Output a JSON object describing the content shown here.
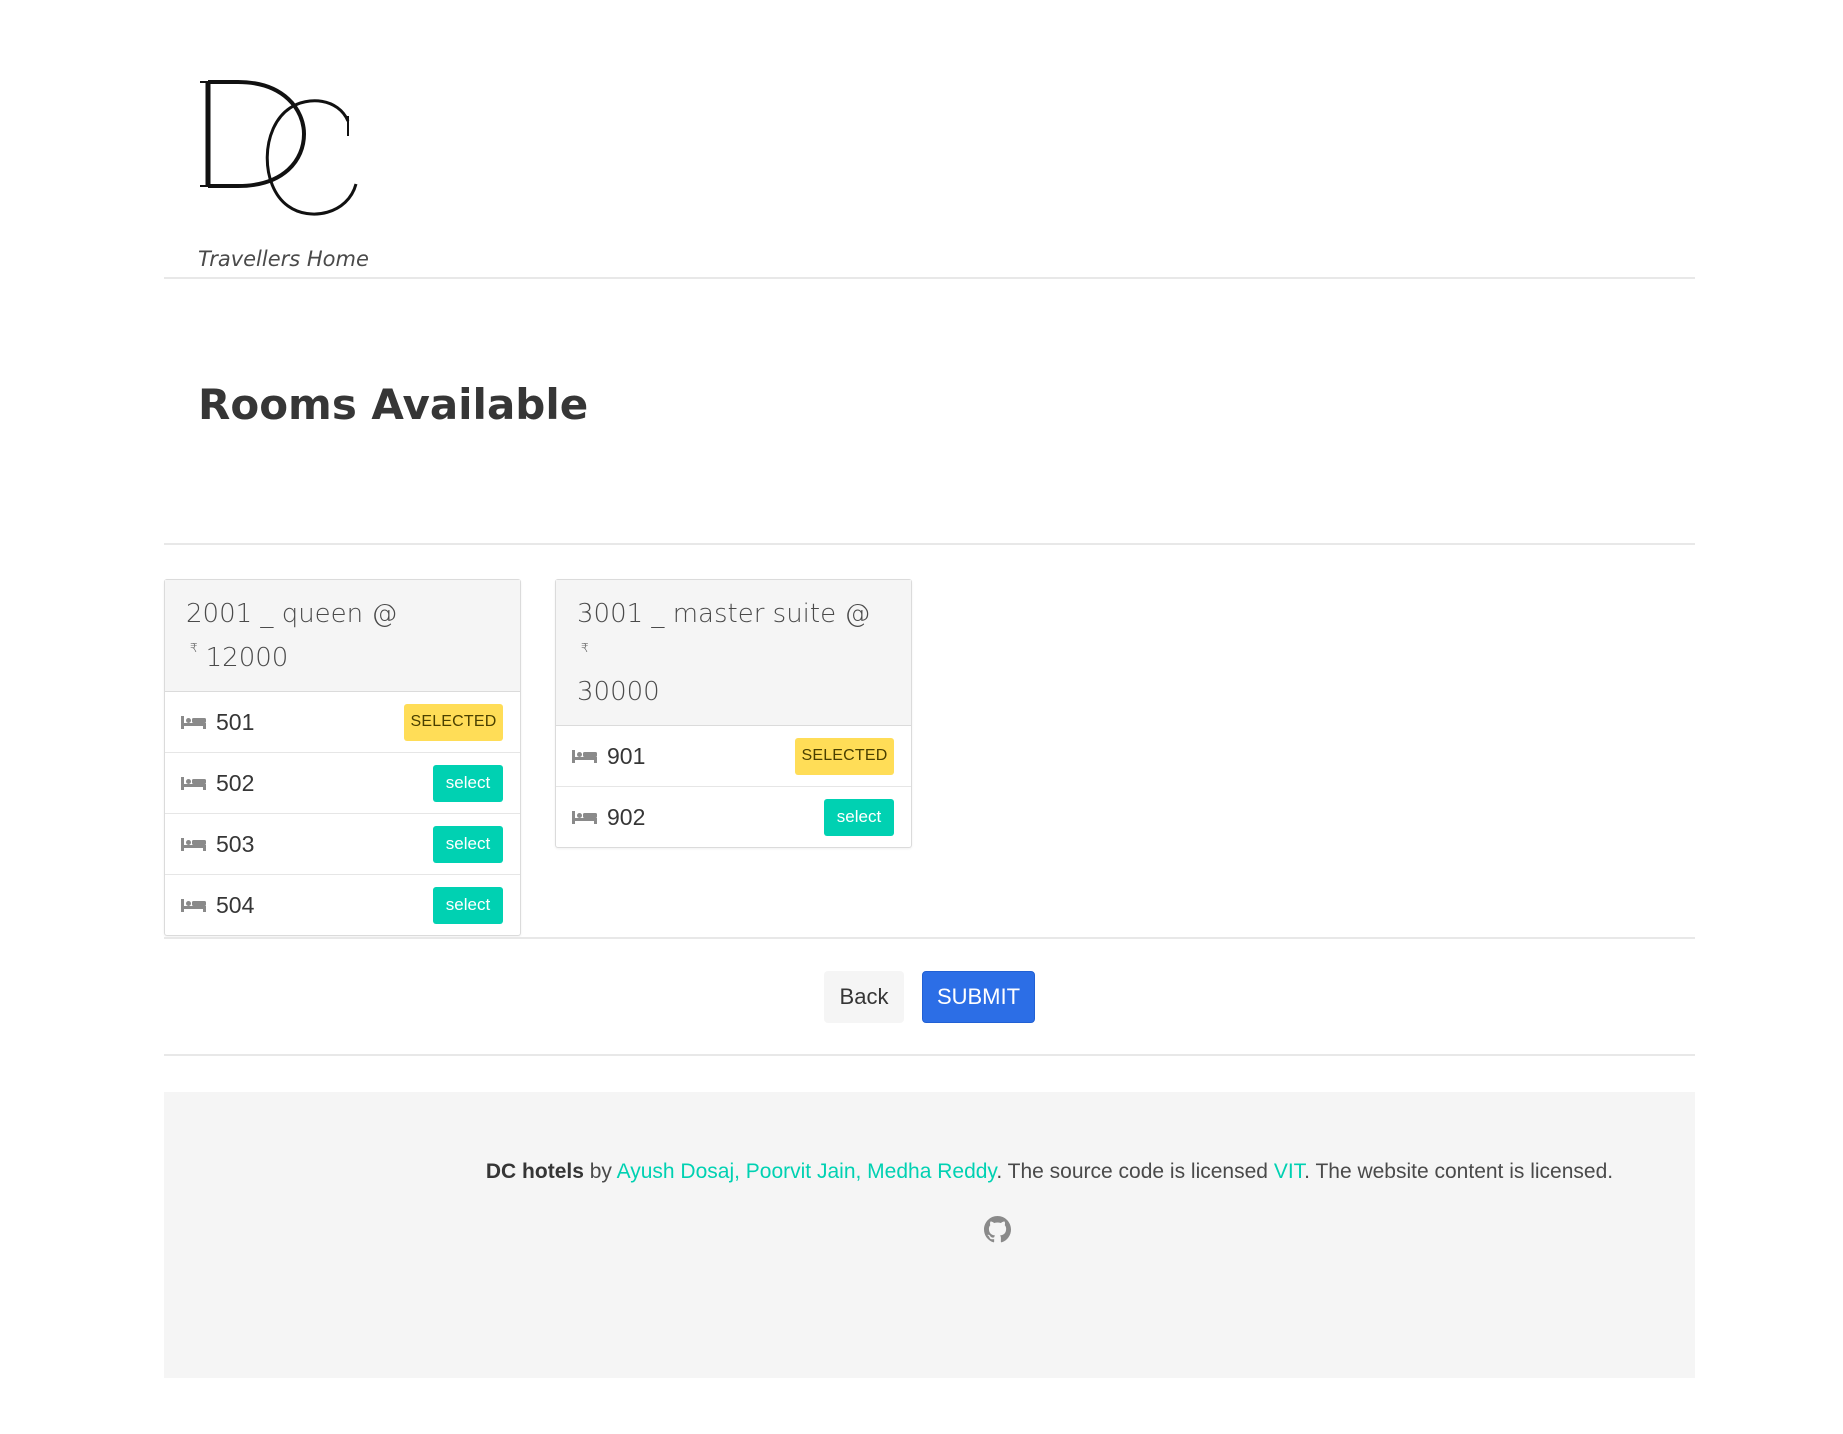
{
  "header": {
    "logo_letters": "DC",
    "tagline": "Travellers Home"
  },
  "page": {
    "title": "Rooms Available"
  },
  "room_types": [
    {
      "title": "2001 _ queen @",
      "currency": "₹",
      "price": "12000",
      "rooms": [
        {
          "number": "501",
          "status": "SELECTED"
        },
        {
          "number": "502",
          "status": "select"
        },
        {
          "number": "503",
          "status": "select"
        },
        {
          "number": "504",
          "status": "select"
        }
      ]
    },
    {
      "title": "3001 _ master suite @",
      "currency": "₹",
      "price": "30000",
      "rooms": [
        {
          "number": "901",
          "status": "SELECTED"
        },
        {
          "number": "902",
          "status": "select"
        }
      ]
    }
  ],
  "actions": {
    "back_label": "Back",
    "submit_label": "SUBMIT"
  },
  "footer": {
    "brand": "DC hotels",
    "by": " by ",
    "authors": "Ayush Dosaj, Poorvit Jain, Medha Reddy",
    "license_text": ". The source code is licensed ",
    "license_link": "VIT",
    "content_text": ". The website content is licensed."
  },
  "icons": {
    "room": "bed-icon",
    "footer": "github-icon"
  },
  "colors": {
    "selected_tag": "#ffdd57",
    "select_button": "#00d1b2",
    "submit_button": "#2c6ee6",
    "link": "#00d1b2"
  }
}
